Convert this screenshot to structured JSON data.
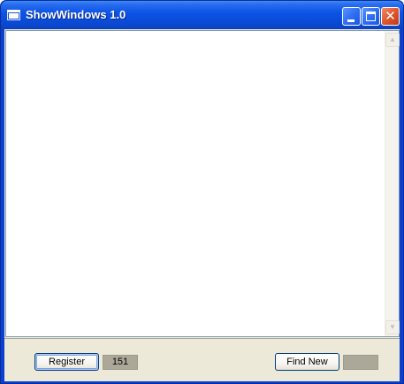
{
  "window": {
    "title": "ShowWindows 1.0",
    "icon": "window-app-icon"
  },
  "caption_buttons": {
    "minimize_icon": "minimize-icon",
    "maximize_icon": "maximize-icon",
    "close_icon": "close-icon",
    "close_glyph": "✕"
  },
  "list": {
    "items": []
  },
  "scrollbar": {
    "up_glyph": "▲",
    "down_glyph": "▼"
  },
  "footer": {
    "register_label": "Register",
    "register_count": "151",
    "find_new_label": "Find New",
    "find_new_count": ""
  },
  "colors": {
    "titlebar": "#0a4cd8",
    "close_button": "#e0552d",
    "window_face": "#ece9d8",
    "readout_bg": "#aca899"
  }
}
